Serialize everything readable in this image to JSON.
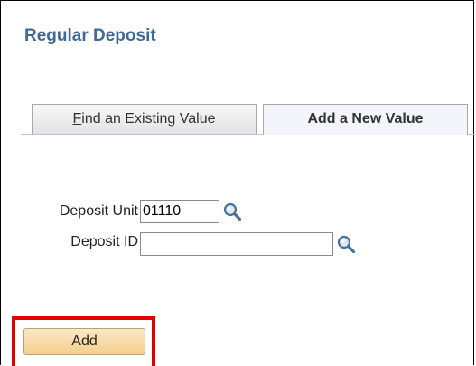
{
  "page": {
    "title": "Regular Deposit"
  },
  "tabs": {
    "find_first_letter": "F",
    "find_rest": "ind an Existing Value",
    "add": "Add a New Value"
  },
  "form": {
    "deposit_unit_label": "Deposit Unit",
    "deposit_unit_value": "01110",
    "deposit_id_label": "Deposit ID",
    "deposit_id_value": ""
  },
  "actions": {
    "add_label": "Add"
  },
  "icons": {
    "lookup": "magnifying-glass-icon"
  },
  "colors": {
    "title": "#3e6998",
    "highlight": "#e00000",
    "button_fill": "#f4cf8e"
  }
}
